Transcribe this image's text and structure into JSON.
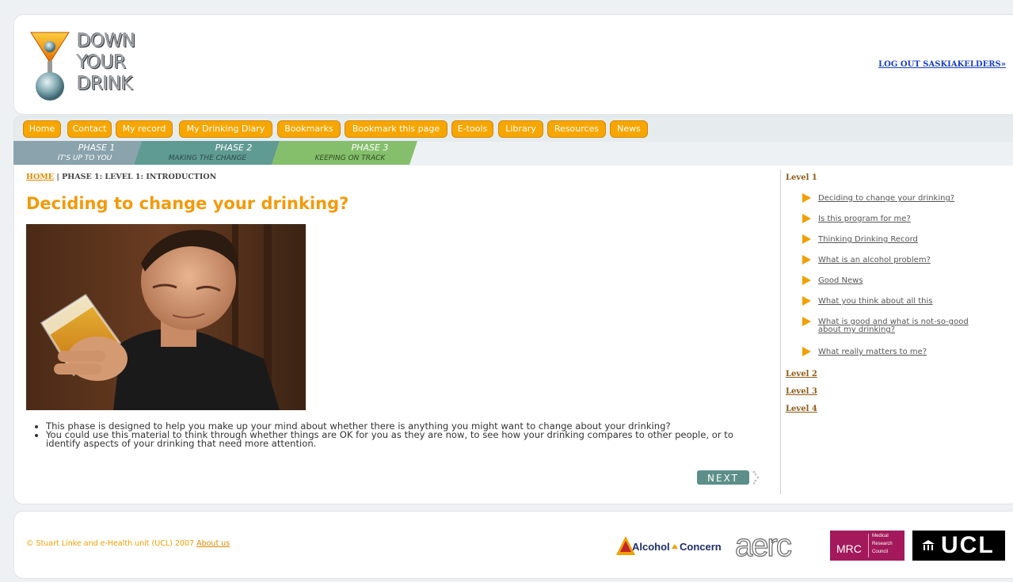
{
  "header": {
    "logo": {
      "line1": "DOWN",
      "line2": "YOUR",
      "line3": "DRINK"
    },
    "logout": "LOG OUT SASKIAKELDERS»"
  },
  "nav": {
    "items": [
      "Home",
      "Contact",
      "My record",
      "My Drinking Diary",
      "Bookmarks",
      "Bookmark this page",
      "E-tools",
      "Library",
      "Resources",
      "News"
    ]
  },
  "phases": [
    {
      "title": "PHASE 1",
      "subtitle": "IT'S UP TO YOU",
      "color": "#8aa3ad"
    },
    {
      "title": "PHASE 2",
      "subtitle": "MAKING THE CHANGE",
      "color": "#5f9b93"
    },
    {
      "title": "PHASE 3",
      "subtitle": "KEEPING ON TRACK",
      "color": "#85bf6c"
    }
  ],
  "breadcrumb": {
    "home": "HOME",
    "sep": " | ",
    "current": "PHASE 1: LEVEL 1: INTRODUCTION"
  },
  "main": {
    "title": "Deciding to change your drinking?",
    "bullets": [
      "This phase is designed to help you make up your mind about whether there is anything you might want to change about your drinking?",
      "You could use this material to think through whether things are OK for you as they are now, to see how your drinking compares to other people, or to identify aspects of your drinking that need more attention."
    ],
    "next": "NEXT"
  },
  "sidebar": {
    "level1": "Level 1",
    "items": [
      "Deciding to change your drinking?",
      "Is this program for me?",
      "Thinking Drinking Record",
      "What is an alcohol problem?",
      "Good News",
      "What you think about all this",
      "What is good and what is not-so-good about my drinking?",
      "What really matters to me?"
    ],
    "level2": "Level 2",
    "level3": "Level 3",
    "level4": "Level 4"
  },
  "footer": {
    "copyright": "© Stuart Linke and e-Health unit (UCL) 2007 ",
    "about": "About us",
    "logos": {
      "alcohol_concern": "Alcohol",
      "alcohol_concern2": "Concern",
      "aerc": "aerc",
      "mrc": "MRC",
      "mrc_sub1": "Medical",
      "mrc_sub2": "Research",
      "mrc_sub3": "Council",
      "ucl": "UCL"
    }
  },
  "colors": {
    "accent": "#f39a0c",
    "link": "#1a3fbf",
    "nav": "#f7a600",
    "mrc": "#a3195b"
  }
}
